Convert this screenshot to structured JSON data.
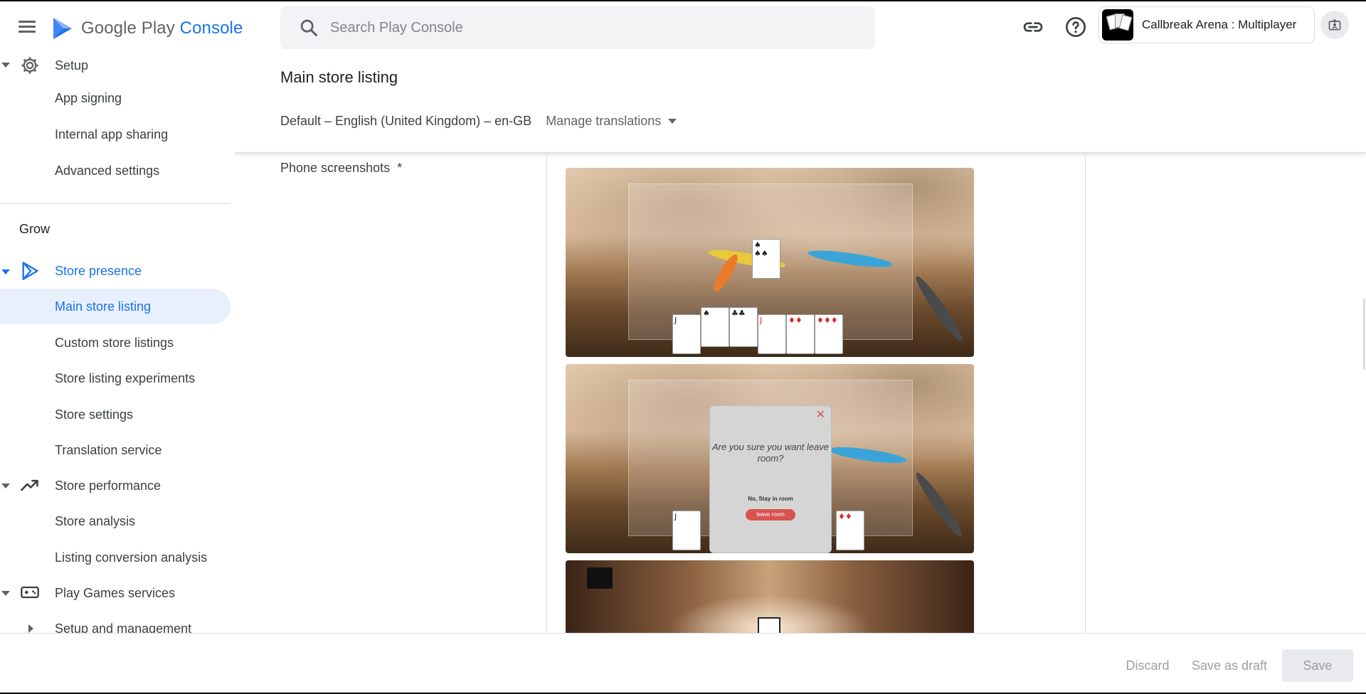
{
  "header": {
    "logo_google_play": "Google Play",
    "logo_console": "Console",
    "search_placeholder": "Search Play Console",
    "app_name": "Callbreak Arena : Multiplayer"
  },
  "sidebar": {
    "setup": "Setup",
    "app_signing": "App signing",
    "internal_app_sharing": "Internal app sharing",
    "advanced_settings": "Advanced settings",
    "grow": "Grow",
    "store_presence": "Store presence",
    "main_store_listing": "Main store listing",
    "custom_store_listings": "Custom store listings",
    "store_listing_experiments": "Store listing experiments",
    "store_settings": "Store settings",
    "translation_service": "Translation service",
    "store_performance": "Store performance",
    "store_analysis": "Store analysis",
    "listing_conversion_analysis": "Listing conversion analysis",
    "play_games_services": "Play Games services",
    "setup_and_management": "Setup and management"
  },
  "main": {
    "title": "Main store listing",
    "language": "Default – English (United Kingdom) – en-GB",
    "manage_translations": "Manage translations",
    "phone_screenshots_label": "Phone screenshots",
    "required_marker": "*",
    "dialog_text": "Are you sure you want leave room?",
    "dialog_stay": "No, Stay in room",
    "dialog_leave": "leave room"
  },
  "footer": {
    "discard": "Discard",
    "save_as_draft": "Save as draft",
    "save": "Save"
  },
  "colors": {
    "accent": "#1a73e8",
    "active_bg": "#e8f0fe",
    "disabled_text": "#9aa0a6"
  }
}
